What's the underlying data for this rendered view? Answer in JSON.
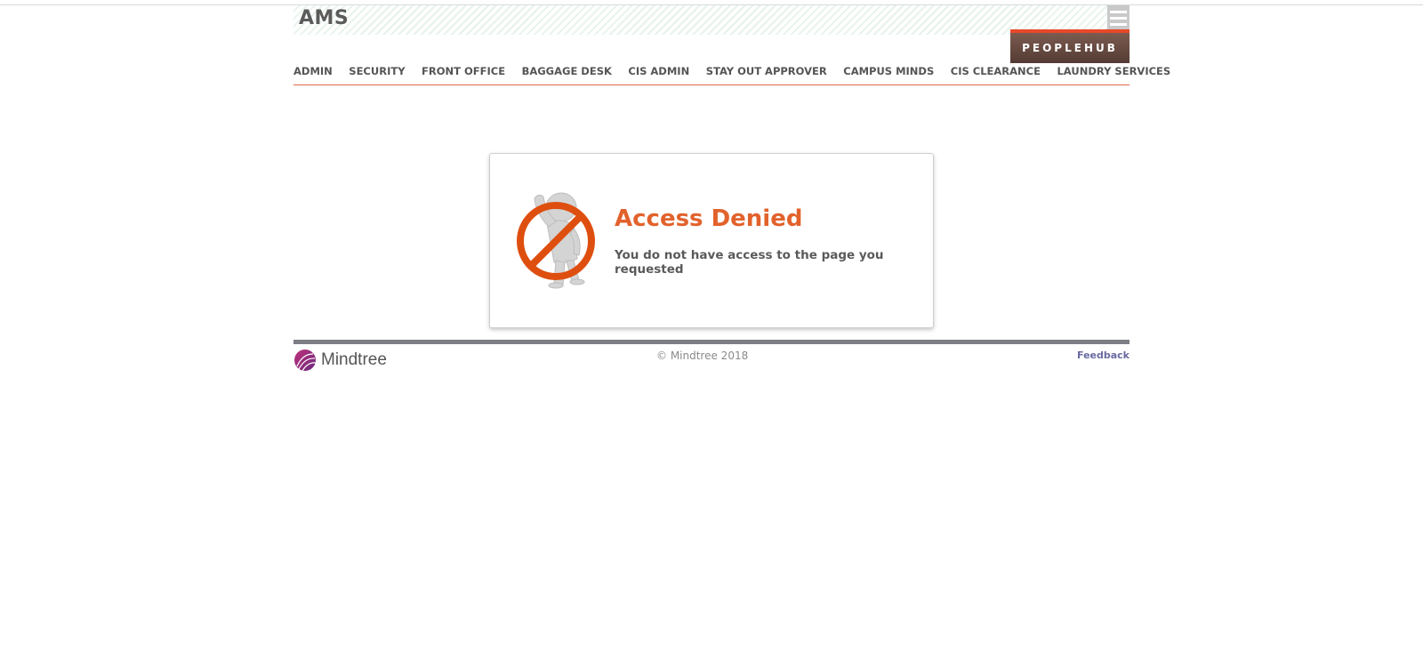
{
  "header": {
    "app_title": "AMS",
    "brand_button": "PEOPLEHUB",
    "menu_icon": "hamburger-icon"
  },
  "nav": {
    "items": [
      {
        "label": "ADMIN"
      },
      {
        "label": "SECURITY"
      },
      {
        "label": "FRONT OFFICE"
      },
      {
        "label": "BAGGAGE DESK"
      },
      {
        "label": "CIS ADMIN"
      },
      {
        "label": "STAY OUT APPROVER"
      },
      {
        "label": "CAMPUS MINDS"
      },
      {
        "label": "CIS CLEARANCE"
      },
      {
        "label": "LAUNDRY SERVICES"
      }
    ]
  },
  "error": {
    "icon": "access-denied-figure-icon",
    "title": "Access Denied",
    "message": "You do not have access to the page you requested"
  },
  "footer": {
    "logo_text": "Mindtree",
    "copyright": "© Mindtree 2018",
    "feedback": "Feedback"
  },
  "colors": {
    "accent": "#e2622c",
    "nav_rule": "#e3664a",
    "brand_button_bg": "#5e4238",
    "brand_button_bar": "#e8492a",
    "footer_rule": "#7d7d85"
  }
}
